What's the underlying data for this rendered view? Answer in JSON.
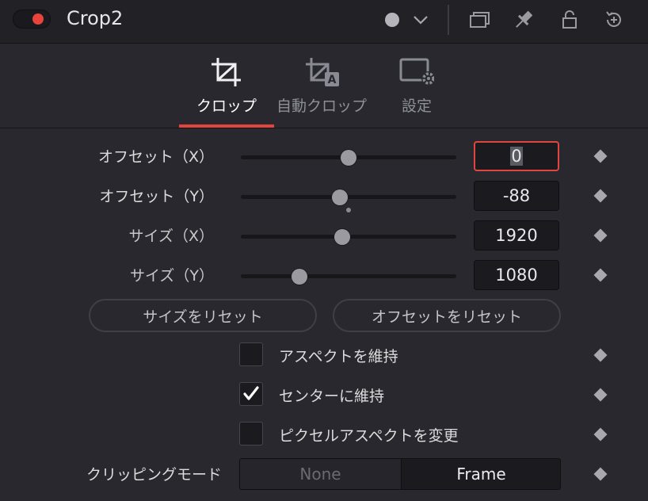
{
  "header": {
    "title": "Crop2",
    "toggle_color": "#e8443b"
  },
  "tabs": [
    {
      "label": "クロップ",
      "icon": "crop-icon",
      "active": true
    },
    {
      "label": "自動クロップ",
      "icon": "auto-crop-icon",
      "active": false
    },
    {
      "label": "設定",
      "icon": "settings-icon",
      "active": false
    }
  ],
  "controls": {
    "offset_x": {
      "label": "オフセット（X）",
      "value": "0",
      "slider_fraction": 0.5
    },
    "offset_y": {
      "label": "オフセット（Y）",
      "value": "-88",
      "slider_fraction": 0.46
    },
    "size_x": {
      "label": "サイズ（X）",
      "value": "1920",
      "slider_fraction": 0.47
    },
    "size_y": {
      "label": "サイズ（Y）",
      "value": "1080",
      "slider_fraction": 0.27
    }
  },
  "buttons": {
    "reset_size": "サイズをリセット",
    "reset_offset": "オフセットをリセット"
  },
  "checkboxes": [
    {
      "label": "アスペクトを維持",
      "checked": false
    },
    {
      "label": "センターに維持",
      "checked": true
    },
    {
      "label": "ピクセルアスペクトを変更",
      "checked": false
    }
  ],
  "clipping": {
    "label": "クリッピングモード",
    "options": [
      "None",
      "Frame"
    ],
    "selected": "Frame"
  },
  "accent_color": "#e2453d"
}
